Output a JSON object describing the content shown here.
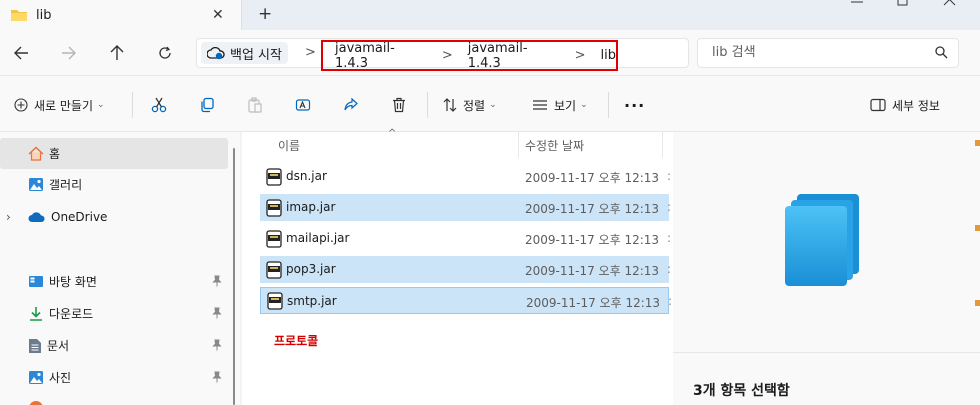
{
  "tab": {
    "title": "lib",
    "close_symbol": "✕",
    "new_tab_symbol": "+"
  },
  "address": {
    "backup_label": "백업 시작",
    "breadcrumb": [
      "javamail-1.4.3",
      "javamail-1.4.3",
      "lib"
    ],
    "separator": ">"
  },
  "search": {
    "placeholder": "lib 검색"
  },
  "commands": {
    "new_label": "새로 만들기",
    "sort_label": "정렬",
    "view_label": "보기",
    "more_label": "···",
    "details_label": "세부 정보"
  },
  "sidebar": {
    "items": [
      {
        "label": "홈",
        "icon": "home-icon"
      },
      {
        "label": "갤러리",
        "icon": "gallery-icon"
      },
      {
        "label": "OneDrive",
        "icon": "cloud-icon"
      },
      {
        "label": "바탕 화면",
        "icon": "desktop-icon"
      },
      {
        "label": "다운로드",
        "icon": "download-icon"
      },
      {
        "label": "문서",
        "icon": "document-icon"
      },
      {
        "label": "사진",
        "icon": "pictures-icon"
      }
    ]
  },
  "columns": {
    "name": "이름",
    "modified": "수정한 날짜"
  },
  "files": [
    {
      "name": "dsn.jar",
      "modified": "2009-11-17 오후 12:13",
      "selected": false
    },
    {
      "name": "imap.jar",
      "modified": "2009-11-17 오후 12:13",
      "selected": true
    },
    {
      "name": "mailapi.jar",
      "modified": "2009-11-17 오후 12:13",
      "selected": false
    },
    {
      "name": "pop3.jar",
      "modified": "2009-11-17 오후 12:13",
      "selected": true
    },
    {
      "name": "smtp.jar",
      "modified": "2009-11-17 오후 12:13",
      "selected": true
    }
  ],
  "annotation": "프로토콜",
  "preview": {
    "selection_text": "3개 항목 선택함"
  },
  "colors": {
    "accent": "#0067c0",
    "selection": "#cce4f7",
    "highlight_box": "#e00000",
    "annotation": "#d40000"
  }
}
